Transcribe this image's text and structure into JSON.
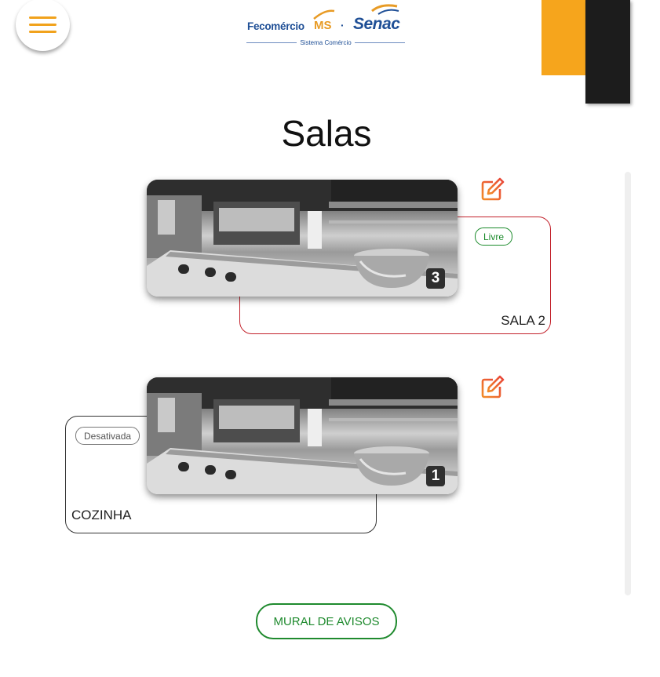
{
  "header": {
    "logo_fecomercio": "Fecomércio",
    "logo_ms": "MS",
    "logo_separator": "·",
    "logo_senac": "Senac",
    "logo_subtitle": "Sistema Comércio"
  },
  "page": {
    "title": "Salas"
  },
  "rooms": [
    {
      "name": "SALA 2",
      "status": "Livre",
      "count": "3"
    },
    {
      "name": "COZINHA",
      "status": "Desativada",
      "count": "1"
    }
  ],
  "footer": {
    "mural_label": "MURAL DE AVISOS"
  },
  "colors": {
    "accent_orange": "#f6a51c",
    "dark_block": "#1c1c1c",
    "brand_blue": "#1f4f96",
    "status_green": "#1a8a2a",
    "border_red": "#c2212b"
  },
  "icons": {
    "menu": "hamburger-icon",
    "edit": "edit-icon"
  }
}
